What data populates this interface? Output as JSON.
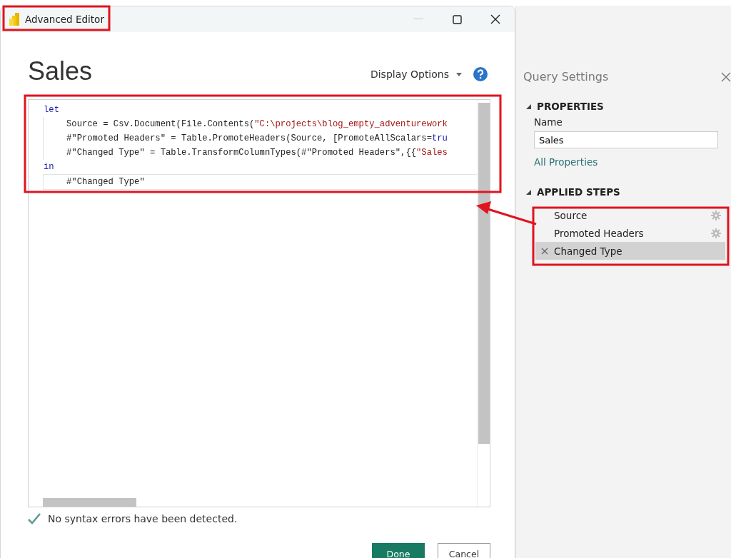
{
  "window": {
    "title": "Advanced Editor"
  },
  "query_title": "Sales",
  "display_options": "Display Options",
  "editor": {
    "lines": [
      {
        "indented": false,
        "current": false,
        "segments": [
          {
            "kind": "keyword",
            "text": "let"
          }
        ]
      },
      {
        "indented": true,
        "current": false,
        "segments": [
          {
            "kind": "plain",
            "text": "Source = Csv.Document(File.Contents("
          },
          {
            "kind": "string",
            "text": "\"C:\\projects\\blog_empty_adventurework"
          }
        ]
      },
      {
        "indented": true,
        "current": false,
        "segments": [
          {
            "kind": "plain",
            "text": "#\"Promoted Headers\" = Table.PromoteHeaders(Source, [PromoteAllScalars="
          },
          {
            "kind": "keyword",
            "text": "tru"
          }
        ]
      },
      {
        "indented": true,
        "current": false,
        "segments": [
          {
            "kind": "plain",
            "text": "#\"Changed Type\" = Table.TransformColumnTypes(#\"Promoted Headers\",{{"
          },
          {
            "kind": "string",
            "text": "\"Sales"
          }
        ]
      },
      {
        "indented": false,
        "current": false,
        "segments": [
          {
            "kind": "keyword",
            "text": "in"
          }
        ]
      },
      {
        "indented": true,
        "current": true,
        "segments": [
          {
            "kind": "plain",
            "text": "#\"Changed Type\""
          }
        ]
      }
    ]
  },
  "status": {
    "ok": true,
    "text": "No syntax errors have been detected."
  },
  "buttons": [
    {
      "kind": "primary",
      "label": "Done"
    },
    {
      "kind": "secondary",
      "label": "Cancel"
    }
  ],
  "query_settings": {
    "title": "Query Settings",
    "properties": {
      "heading": "PROPERTIES",
      "name_label": "Name",
      "name_value": "Sales",
      "link": "All Properties"
    },
    "applied_steps": {
      "heading": "APPLIED STEPS",
      "steps": [
        {
          "label": "Source",
          "selected": false,
          "has_settings": true
        },
        {
          "label": "Promoted Headers",
          "selected": false,
          "has_settings": true
        },
        {
          "label": "Changed Type",
          "selected": true,
          "has_settings": false
        }
      ]
    }
  }
}
